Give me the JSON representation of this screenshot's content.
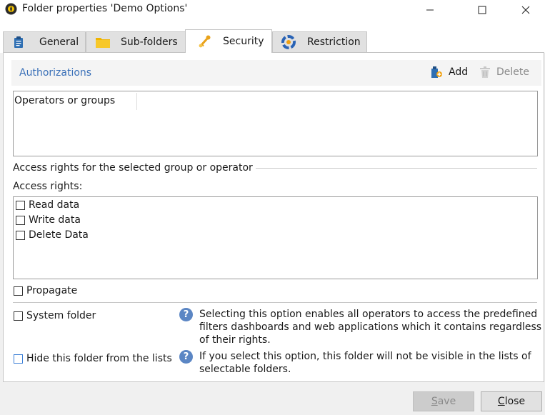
{
  "window": {
    "title": "Folder properties 'Demo Options'"
  },
  "tabs": [
    {
      "label": "General",
      "icon": "clipboard-icon"
    },
    {
      "label": "Sub-folders",
      "icon": "folder-icon"
    },
    {
      "label": "Security",
      "icon": "key-icon",
      "active": true
    },
    {
      "label": "Restriction",
      "icon": "restriction-icon"
    }
  ],
  "authorizations": {
    "title": "Authorizations",
    "add_label": "Add",
    "delete_label": "Delete",
    "column_header": "Operators or groups"
  },
  "access": {
    "group_label": "Access rights for the selected group or operator",
    "rights_label": "Access rights:",
    "rights": [
      {
        "label": "Read data",
        "checked": false
      },
      {
        "label": "Write data",
        "checked": false
      },
      {
        "label": "Delete Data",
        "checked": false
      }
    ],
    "propagate_label": "Propagate"
  },
  "options": {
    "system_folder_label": "System folder",
    "system_folder_help": "Selecting this option enables all operators to access the predefined filters dashboards and web applications which it contains regardless of their rights.",
    "hide_folder_label": "Hide this folder from the lists",
    "hide_folder_help": "If you select this option, this folder will not be visible in the lists of selectable folders."
  },
  "buttons": {
    "save_label": "Save",
    "close_label": "Close"
  },
  "colors": {
    "link_blue": "#3a70b8",
    "help_blue": "#5b86c4",
    "focus_blue": "#3c7fd6"
  }
}
